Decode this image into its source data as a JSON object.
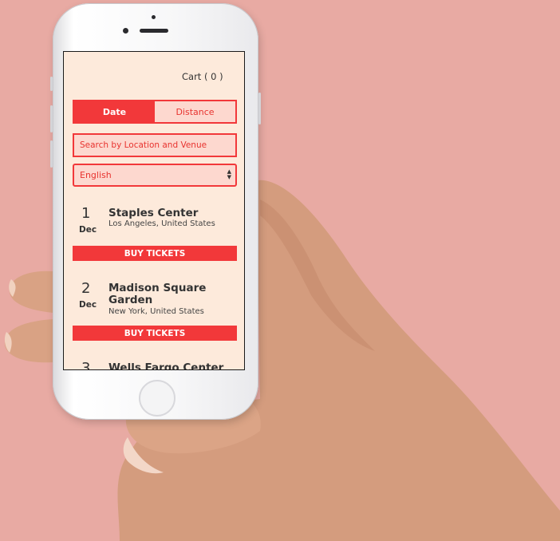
{
  "header": {
    "cart_label": "Cart ( 0 )"
  },
  "sort": {
    "options": [
      {
        "label": "Date",
        "active": true
      },
      {
        "label": "Distance",
        "active": false
      }
    ]
  },
  "search": {
    "placeholder": "Search by Location and Venue"
  },
  "language": {
    "selected": "English"
  },
  "events": [
    {
      "day": "1",
      "month": "Dec",
      "venue": "Staples Center",
      "location": "Los Angeles, United States",
      "button": "BUY TICKETS"
    },
    {
      "day": "2",
      "month": "Dec",
      "venue": "Madison Square Garden",
      "location": "New York, United States",
      "button": "BUY TICKETS"
    },
    {
      "day": "3",
      "venue": "Wells Fargo Center"
    }
  ],
  "colors": {
    "accent": "#f2383a",
    "screen_background": "#fdeadb",
    "input_background": "#fdd8cf",
    "page_background": "#e8aaa3"
  }
}
